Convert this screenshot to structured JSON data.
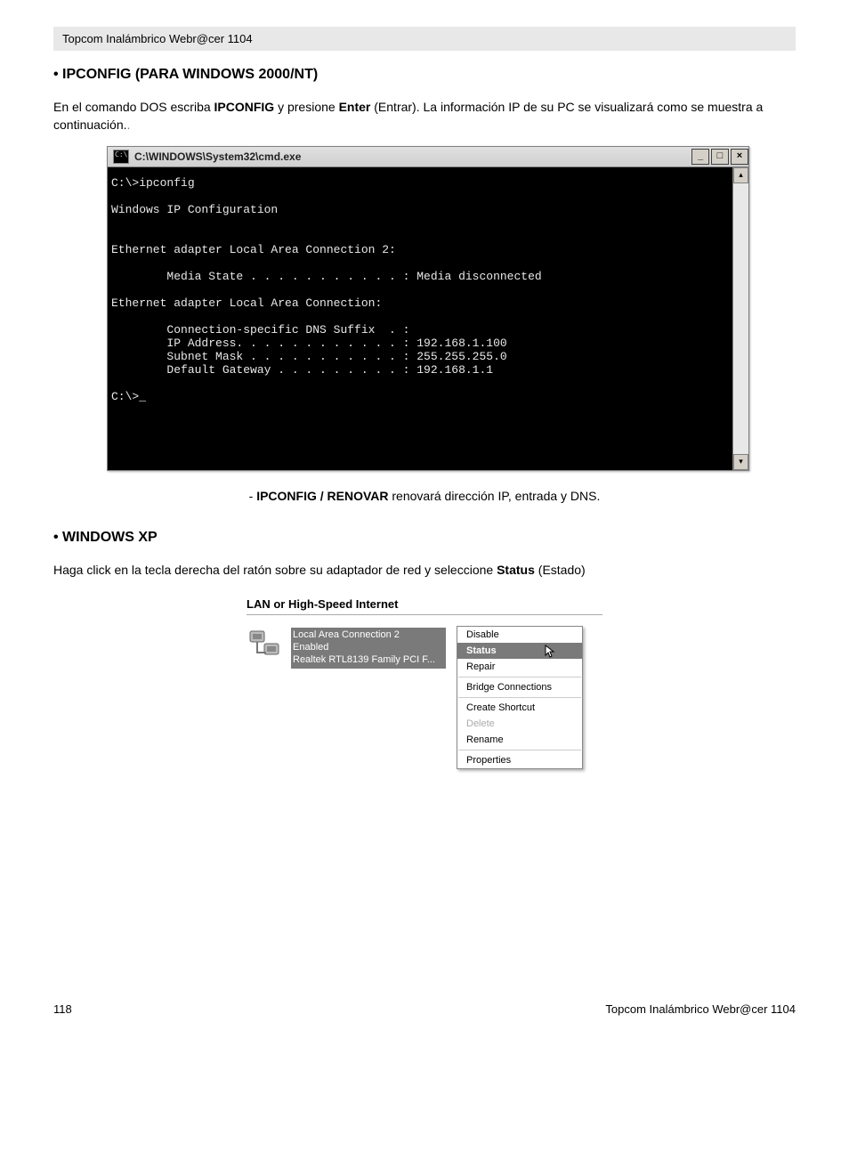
{
  "header": {
    "text": "Topcom Inalámbrico Webr@cer 1104"
  },
  "section1": {
    "title": "• IPCONFIG (PARA WINDOWS 2000/NT)",
    "intro_before_bold1": "En el comando DOS escriba ",
    "bold1": "IPCONFIG",
    "intro_mid": " y presione ",
    "bold2": "Enter",
    "intro_after_bold2": " (Entrar). La información IP de su PC se visualizará como se muestra a continuación.",
    "trailing_dot": "."
  },
  "cmd": {
    "title": "C:\\WINDOWS\\System32\\cmd.exe",
    "minimize": "_",
    "maximize": "□",
    "close": "×",
    "scroll_up": "▴",
    "scroll_down": "▾",
    "lines": "C:\\>ipconfig\n\nWindows IP Configuration\n\n\nEthernet adapter Local Area Connection 2:\n\n        Media State . . . . . . . . . . . : Media disconnected\n\nEthernet adapter Local Area Connection:\n\n        Connection-specific DNS Suffix  . :\n        IP Address. . . . . . . . . . . . : 192.168.1.100\n        Subnet Mask . . . . . . . . . . . : 255.255.255.0\n        Default Gateway . . . . . . . . . : 192.168.1.1\n\nC:\\>_"
  },
  "caption": {
    "prefix": "- ",
    "bold": "IPCONFIG / RENOVAR",
    "rest": " renovará dirección IP, entrada y DNS."
  },
  "section2": {
    "title": "• WINDOWS XP",
    "intro_before": "Haga click en la tecla derecha del ratón sobre su adaptador de red y seleccione ",
    "bold": "Status",
    "intro_after": " (Estado)"
  },
  "xp": {
    "heading": "LAN or High-Speed Internet",
    "conn_name": "Local Area Connection 2",
    "conn_state": "Enabled",
    "conn_adapter": "Realtek RTL8139 Family PCI F...",
    "menu": {
      "disable": "Disable",
      "status": "Status",
      "repair": "Repair",
      "bridge": "Bridge Connections",
      "shortcut": "Create Shortcut",
      "delete": "Delete",
      "rename": "Rename",
      "properties": "Properties"
    }
  },
  "footer": {
    "page": "118",
    "right": "Topcom Inalámbrico Webr@cer 1104"
  }
}
